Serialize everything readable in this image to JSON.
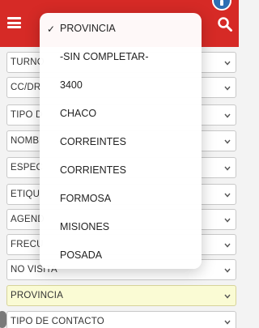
{
  "header": {
    "background_color": "#d62a26",
    "icons": [
      "menu-icon",
      "search-icon",
      "info-icon"
    ]
  },
  "form": {
    "fields": [
      {
        "label": "TURNO"
      },
      {
        "label": "CC/DR"
      },
      {
        "label": "TIPO D"
      },
      {
        "label": "NOMB"
      },
      {
        "label": "ESPEC"
      },
      {
        "label": "ETIQU"
      },
      {
        "label": "AGEND"
      },
      {
        "label": "FRECU"
      },
      {
        "label": "NO VISITA"
      },
      {
        "label": "PROVINCIA",
        "active": true
      },
      {
        "label": "TIPO DE CONTACTO"
      }
    ],
    "active_field_color": "#fafbd4"
  },
  "dropdown": {
    "selected": "PROVINCIA",
    "options": [
      {
        "label": "PROVINCIA",
        "checked": true
      },
      {
        "label": "-SIN COMPLETAR-"
      },
      {
        "label": "3400"
      },
      {
        "label": "CHACO"
      },
      {
        "label": "CORREINTES"
      },
      {
        "label": "CORRIENTES"
      },
      {
        "label": "FORMOSA"
      },
      {
        "label": "MISIONES"
      },
      {
        "label": "POSADA"
      }
    ],
    "check_glyph": "✓"
  }
}
